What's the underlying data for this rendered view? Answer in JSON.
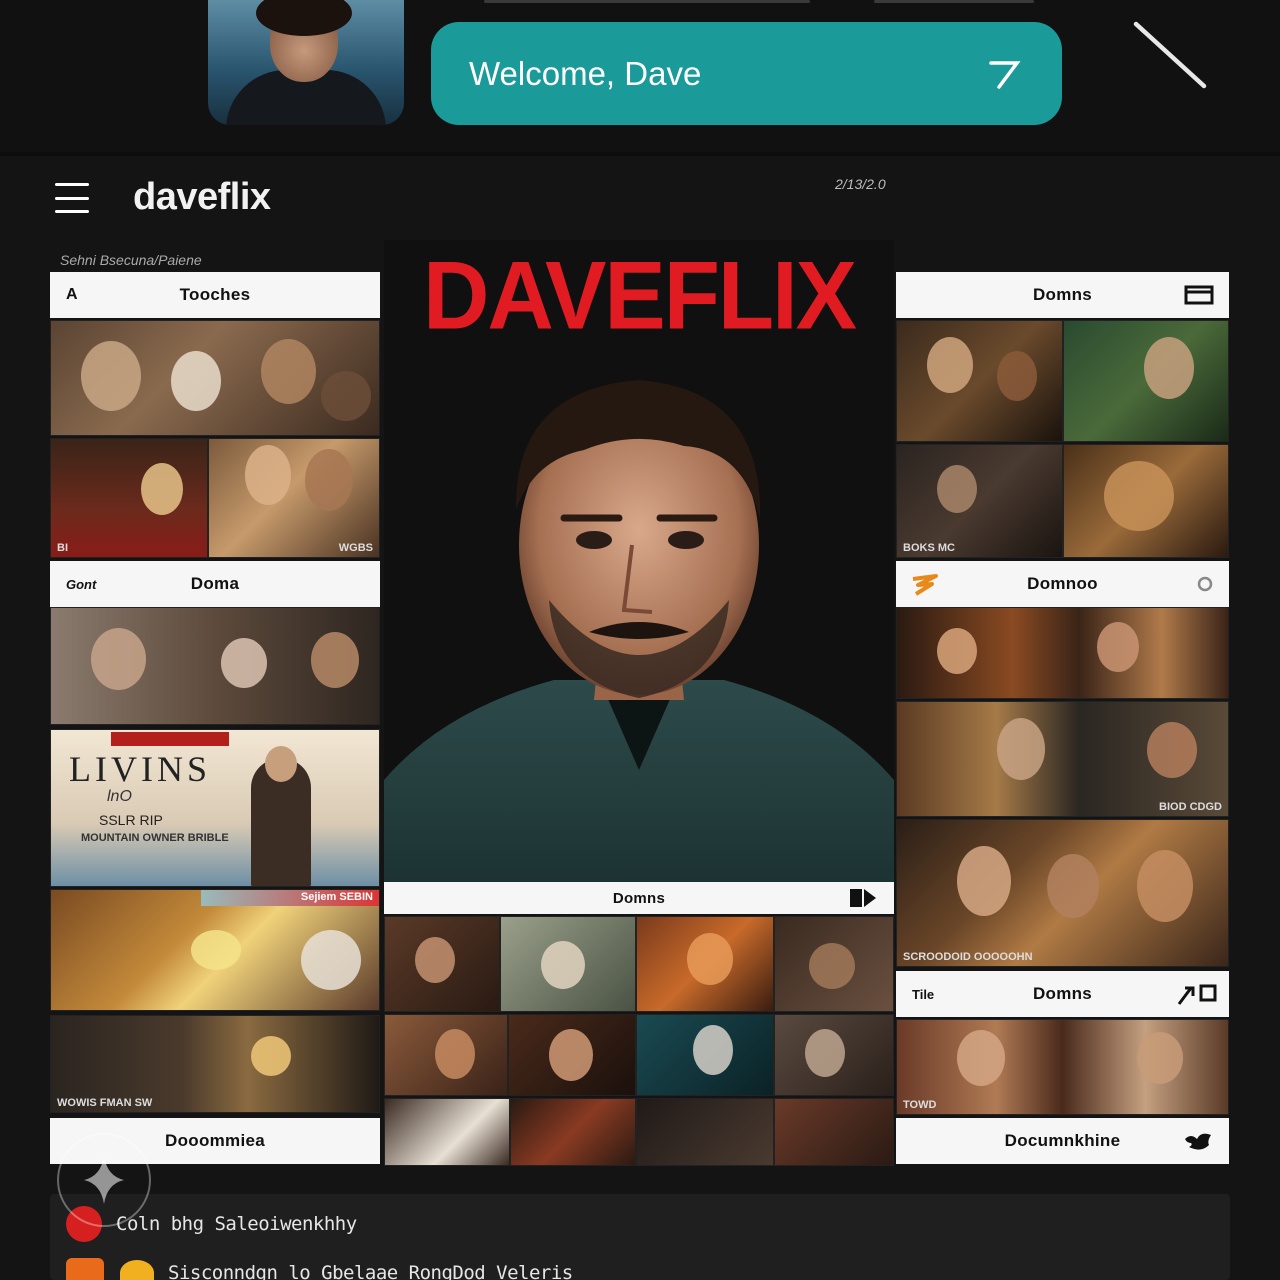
{
  "welcome": {
    "text": "Welcome, Dave",
    "arrow_icon": "arrow-up-right-icon"
  },
  "header": {
    "brand": "daveflix",
    "date_tag": "2/13/2.0",
    "sub_caption": "Sehni Bsecuna/Paiene"
  },
  "hero": {
    "title": "DAVEFLIX",
    "title_color": "#e11b22"
  },
  "panels": {
    "left_top": {
      "lead": "A",
      "label": "Tooches"
    },
    "left_drama": {
      "lead": "Gont",
      "label": "Doma"
    },
    "left_bottom": {
      "label": "Dooommiea"
    },
    "center_bottom": {
      "label": "Domns"
    },
    "right_top": {
      "label": "Domns"
    },
    "right_mid": {
      "label": "Domnoo"
    },
    "right_lower": {
      "lead": "Tile",
      "label": "Domns"
    },
    "right_bottom": {
      "label": "Documnkhine"
    }
  },
  "tile_captions": {
    "left_grid": "WGBS",
    "left_grid_left": "BI",
    "left_mid_strip": "Sejiem SEBIN",
    "left_bottom_strip": "WOWIS FMAN SW",
    "right_grid": "BOKS MC",
    "right_mid": "BIOD CDGD",
    "right_wide": "SCROODOID OOOOOHN",
    "right_bottom": "TOWD"
  },
  "living_poster": {
    "tag": "",
    "title": "LIVINS",
    "line1": "lnO",
    "line2": "SSLR RIP",
    "line3": "MOUNTAIN OWNER BRIBLE"
  },
  "legend": {
    "row1": "Coln bhg Saleoiwenkhhy",
    "row2": "Sisconndgn lo Gbelaae RongDod Veleris"
  },
  "colors": {
    "accent": "#1b9a9a",
    "brand_red": "#e11b22",
    "panel_header": "#f6f6f6"
  }
}
